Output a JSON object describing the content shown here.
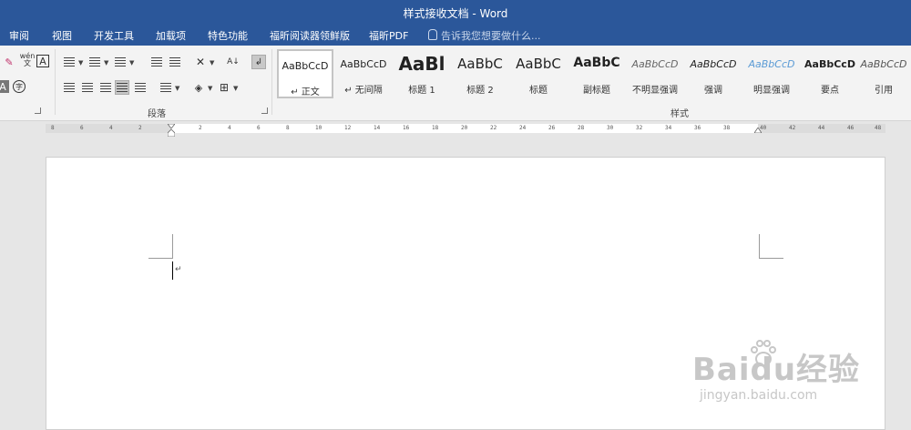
{
  "window": {
    "title": "样式接收文档 - Word"
  },
  "tabs": [
    {
      "label": "审阅"
    },
    {
      "label": "视图"
    },
    {
      "label": "开发工具"
    },
    {
      "label": "加载项"
    },
    {
      "label": "特色功能"
    },
    {
      "label": "福昕阅读器领鲜版"
    },
    {
      "label": "福昕PDF"
    }
  ],
  "tell_me": {
    "placeholder": "告诉我您想要做什么..."
  },
  "ribbon": {
    "paragraph_group_label": "段落",
    "styles_group_label": "样式",
    "font_small_icons": {
      "pinyin": "wén",
      "pinyin_char": "文",
      "char_border": "A",
      "char_shading": "A",
      "enclose": "字"
    }
  },
  "styles": [
    {
      "sample": "AaBbCcD",
      "name": "↵ 正文",
      "active": true
    },
    {
      "sample": "AaBbCcD",
      "name": "↵ 无间隔"
    },
    {
      "sample": "AaBl",
      "name": "标题 1"
    },
    {
      "sample": "AaBbC",
      "name": "标题 2"
    },
    {
      "sample": "AaBbC",
      "name": "标题"
    },
    {
      "sample": "AaBbC",
      "name": "副标题"
    },
    {
      "sample": "AaBbCcD",
      "name": "不明显强调"
    },
    {
      "sample": "AaBbCcD",
      "name": "强调"
    },
    {
      "sample": "AaBbCcD",
      "name": "明显强调"
    },
    {
      "sample": "AaBbCcD",
      "name": "要点"
    },
    {
      "sample": "AaBbCcD",
      "name": "引用"
    }
  ],
  "ruler": {
    "ticks": [
      "8",
      "6",
      "4",
      "2",
      "2",
      "4",
      "6",
      "8",
      "10",
      "12",
      "14",
      "16",
      "18",
      "20",
      "22",
      "24",
      "26",
      "28",
      "30",
      "32",
      "34",
      "36",
      "38",
      "40",
      "42",
      "44",
      "46",
      "48"
    ]
  },
  "document": {
    "paragraph_mark": "↵"
  },
  "watermark": {
    "brand": "Baidu经验",
    "url": "jingyan.baidu.com"
  },
  "colors": {
    "accent": "#2b579a",
    "ribbon": "#f3f3f3",
    "canvas": "#e6e6e6"
  }
}
